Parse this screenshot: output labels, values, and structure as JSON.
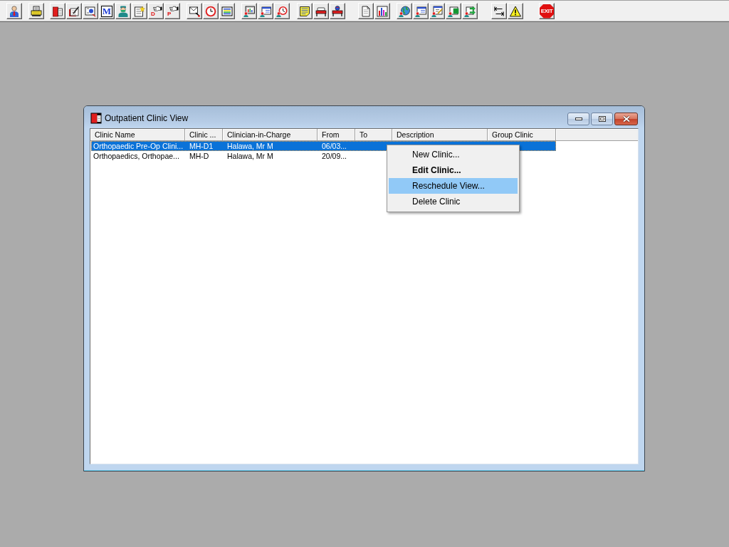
{
  "toolbar": {
    "groups": [
      [
        {
          "kind": "doctor"
        }
      ],
      [
        {
          "kind": "fax"
        }
      ],
      [
        {
          "kind": "book"
        },
        {
          "kind": "notebook"
        },
        {
          "kind": "document"
        },
        {
          "kind": "letter",
          "label": "M"
        },
        {
          "kind": "surgeon"
        },
        {
          "kind": "note"
        },
        {
          "kind": "hand",
          "label": "D"
        },
        {
          "kind": "hand",
          "label": "P"
        }
      ],
      [
        {
          "kind": "envelope"
        },
        {
          "kind": "clock"
        },
        {
          "kind": "list"
        }
      ],
      [
        {
          "kind": "monitor"
        },
        {
          "kind": "card"
        },
        {
          "kind": "timer"
        }
      ],
      [
        {
          "kind": "memo"
        },
        {
          "kind": "bed"
        },
        {
          "kind": "patientbed"
        }
      ],
      [
        {
          "kind": "page"
        },
        {
          "kind": "chart"
        }
      ],
      [
        {
          "kind": "globe"
        },
        {
          "kind": "card"
        },
        {
          "kind": "edit"
        },
        {
          "kind": "grid"
        },
        {
          "kind": "transfer"
        }
      ],
      [
        {
          "kind": "arrows"
        },
        {
          "kind": "warning"
        }
      ],
      [
        {
          "kind": "exit",
          "label": "EXIT"
        }
      ]
    ]
  },
  "window": {
    "title": "Outpatient Clinic View"
  },
  "list": {
    "columns": {
      "clinic_name": "Clinic Name",
      "column_2": "Clinic ...",
      "clinician_in_charge": "Clinician-in-Charge",
      "from": "From",
      "to": "To",
      "description": "Description",
      "group_clinic": "Group Clinic"
    },
    "rows": [
      {
        "selected": true,
        "clinic_name": "Orthopaedic Pre-Op Clini...",
        "column_2": "MH-D1",
        "clinician_in_charge": "Halawa, Mr M",
        "from": "06/03..."
      },
      {
        "selected": false,
        "clinic_name": "Orthopaedics, Orthopae...",
        "column_2": "MH-D",
        "clinician_in_charge": "Halawa, Mr M",
        "from": "20/09..."
      }
    ]
  },
  "context_menu": {
    "items": [
      {
        "label": "New Clinic...",
        "default": false,
        "selected": false
      },
      {
        "label": "Edit Clinic...",
        "default": true,
        "selected": false
      },
      {
        "label": "Reschedule View...",
        "default": false,
        "selected": true
      },
      {
        "label": "Delete Clinic",
        "default": false,
        "selected": false
      }
    ]
  }
}
